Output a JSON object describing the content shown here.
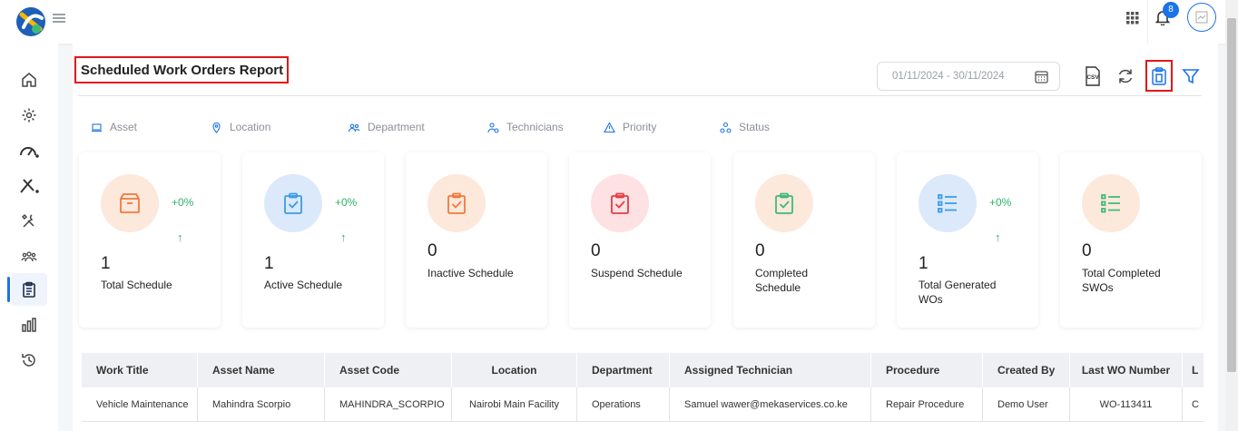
{
  "header": {
    "notification_count": "8"
  },
  "page": {
    "title": "Scheduled Work Orders Report"
  },
  "toolbar": {
    "date_range": "01/11/2024 - 30/11/2024",
    "csv_label": "CSV"
  },
  "filters": [
    {
      "label": "Asset",
      "icon": "laptop-icon"
    },
    {
      "label": "Location",
      "icon": "location-pin-icon"
    },
    {
      "label": "Department",
      "icon": "users-icon"
    },
    {
      "label": "Technicians",
      "icon": "technician-icon"
    },
    {
      "label": "Priority",
      "icon": "warning-triangle-icon"
    },
    {
      "label": "Status",
      "icon": "status-icon"
    }
  ],
  "cards": [
    {
      "count": "1",
      "label": "Total Schedule",
      "change": "+0%",
      "arrow": "↑",
      "icon": "box-icon",
      "color": "#ef7a3a",
      "bg": "#fde8dc"
    },
    {
      "count": "1",
      "label": "Active Schedule",
      "change": "+0%",
      "arrow": "↑",
      "icon": "clipboard-check-icon",
      "color": "#3b9be8",
      "bg": "#dbe9fb"
    },
    {
      "count": "0",
      "label": "Inactive Schedule",
      "icon": "clipboard-check-icon",
      "color": "#ef7a3a",
      "bg": "#fde8dc"
    },
    {
      "count": "0",
      "label": "Suspend Schedule",
      "icon": "clipboard-check-icon",
      "color": "#e53b45",
      "bg": "#fde1e3"
    },
    {
      "count": "0",
      "label": "Completed Schedule",
      "icon": "clipboard-check-icon",
      "color": "#3dbb78",
      "bg": "#fde8dc"
    },
    {
      "count": "1",
      "label": "Total Generated WOs",
      "change": "+0%",
      "arrow": "↑",
      "icon": "list-icon",
      "color": "#3b9be8",
      "bg": "#dbe9fb"
    },
    {
      "count": "0",
      "label": "Total Completed SWOs",
      "icon": "list-icon",
      "color": "#3dbb78",
      "bg": "#fde8dc"
    }
  ],
  "table": {
    "columns": [
      "Work Title",
      "Asset Name",
      "Asset Code",
      "Location",
      "Department",
      "Assigned Technician",
      "Procedure",
      "Created By",
      "Last WO Number",
      "L"
    ],
    "rows": [
      [
        "Vehicle Maintenance",
        "Mahindra Scorpio",
        "MAHINDRA_SCORPIO",
        "Nairobi Main Facility",
        "Operations",
        "Samuel wawer@mekaservices.co.ke",
        "Repair Procedure",
        "Demo User",
        "WO-113411",
        "C"
      ]
    ]
  },
  "colors": {
    "accent": "#1a73e8",
    "highlight": "#e01818",
    "positive": "#2fb36b"
  }
}
